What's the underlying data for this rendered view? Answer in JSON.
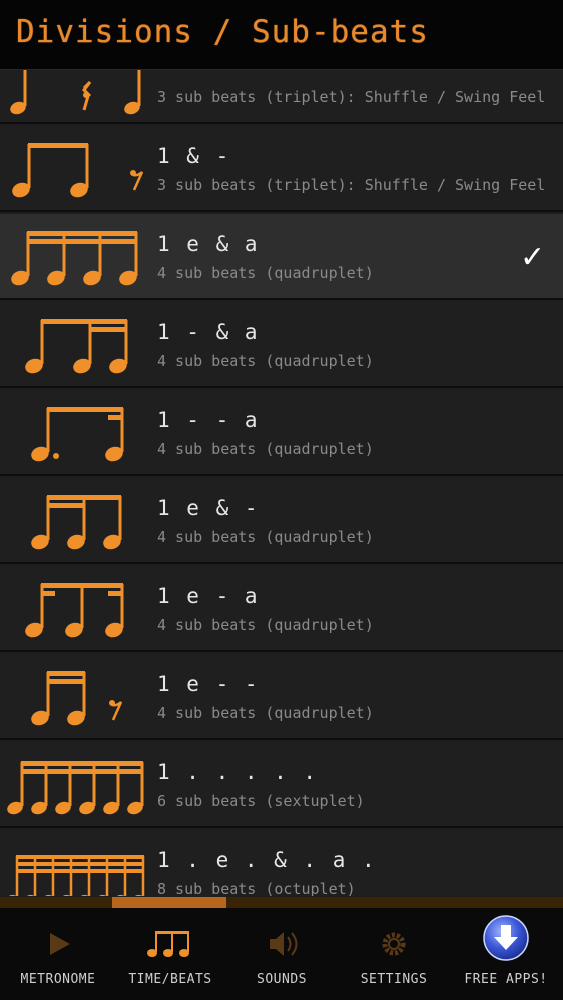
{
  "header": {
    "title": "Divisions / Sub-beats"
  },
  "rows": [
    {
      "pattern": "",
      "desc": "3 sub beats (triplet): Shuffle / Swing Feel",
      "selected": false,
      "icon": "quarter-rest-quarter-notation-icon"
    },
    {
      "pattern": "1 & -",
      "desc": "3 sub beats (triplet): Shuffle / Swing Feel",
      "selected": false,
      "icon": "two-eighths-rest-notation-icon"
    },
    {
      "pattern": "1 e & a",
      "desc": "4 sub beats (quadruplet)",
      "selected": true,
      "icon": "four-sixteenths-notation-icon"
    },
    {
      "pattern": "1 - & a",
      "desc": "4 sub beats (quadruplet)",
      "selected": false,
      "icon": "eighth-two-sixteenths-notation-icon"
    },
    {
      "pattern": "1 - - a",
      "desc": "4 sub beats (quadruplet)",
      "selected": false,
      "icon": "dotted-eighth-sixteenth-notation-icon"
    },
    {
      "pattern": "1 e & -",
      "desc": "4 sub beats (quadruplet)",
      "selected": false,
      "icon": "two-sixteenths-eighth-notation-icon"
    },
    {
      "pattern": "1 e - a",
      "desc": "4 sub beats (quadruplet)",
      "selected": false,
      "icon": "sixteenth-eighth-sixteenth-notation-icon"
    },
    {
      "pattern": "1 e - -",
      "desc": "4 sub beats (quadruplet)",
      "selected": false,
      "icon": "two-sixteenths-rest-notation-icon"
    },
    {
      "pattern": "1 . . . . .",
      "desc": "6 sub beats (sextuplet)",
      "selected": false,
      "icon": "six-sixteenths-notation-icon"
    },
    {
      "pattern": "1 . e . & . a .",
      "desc": "8 sub beats (octuplet)",
      "selected": false,
      "icon": "eight-thirtyseconds-notation-icon"
    }
  ],
  "check_glyph": "✓",
  "tabs": [
    {
      "label": "METRONOME",
      "icon": "play-icon"
    },
    {
      "label": "TIME/BEATS",
      "icon": "eighth-notes-icon"
    },
    {
      "label": "SOUNDS",
      "icon": "speaker-icon"
    },
    {
      "label": "SETTINGS",
      "icon": "gear-icon"
    },
    {
      "label": "FREE APPS!",
      "icon": "download-icon"
    }
  ],
  "colors": {
    "accent": "#e8892b",
    "background": "#1e1e1e",
    "selected_row": "#2e2e2e"
  }
}
